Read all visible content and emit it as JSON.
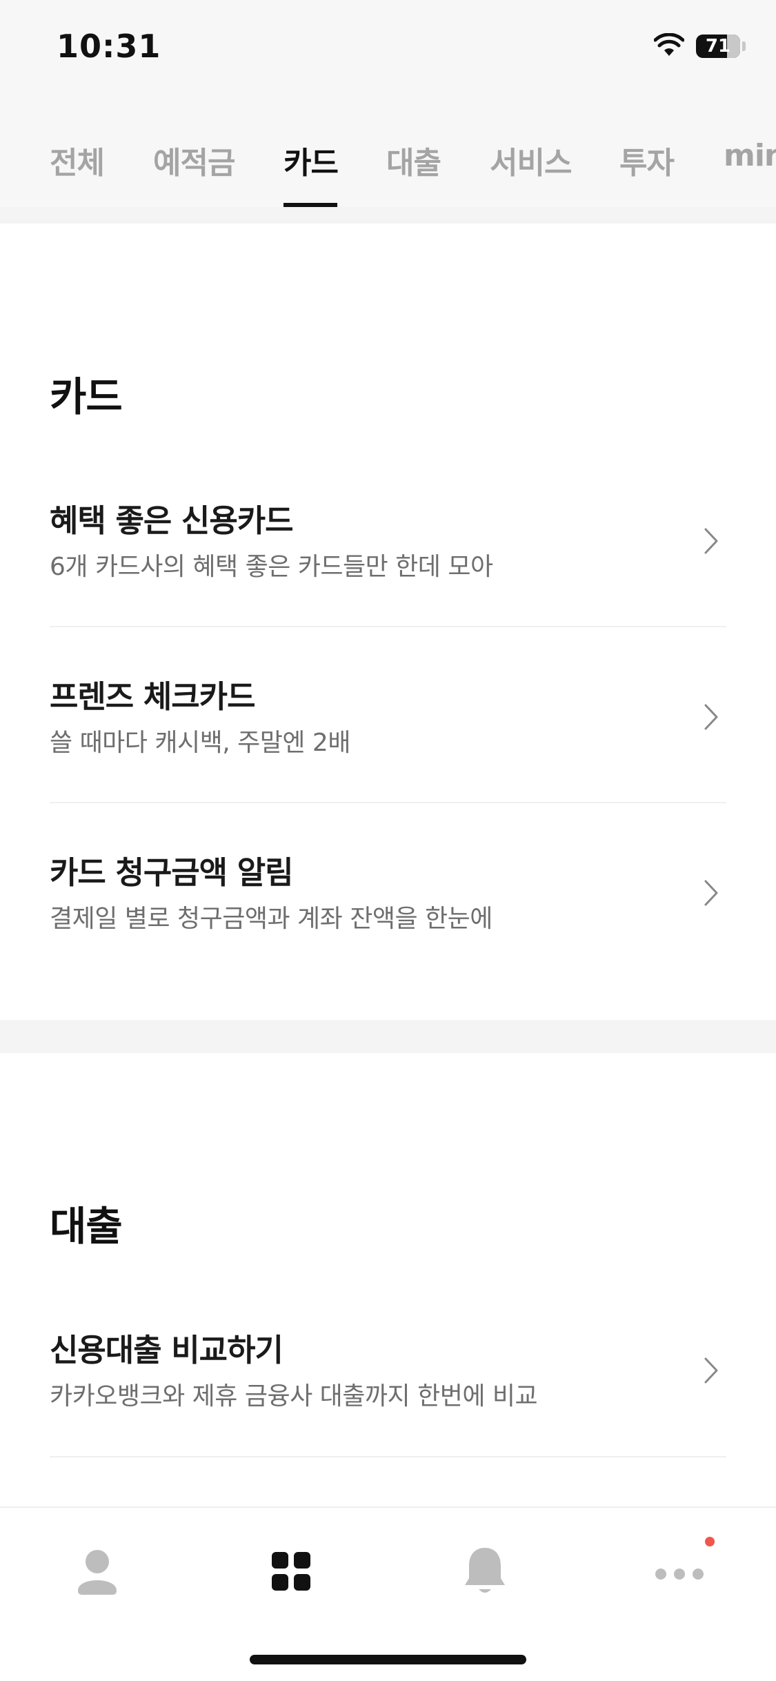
{
  "status_bar": {
    "time": "10:31",
    "battery_level": "71",
    "battery_fraction": 0.71
  },
  "tabs": [
    {
      "label": "전체",
      "active": false
    },
    {
      "label": "예적금",
      "active": false
    },
    {
      "label": "카드",
      "active": true
    },
    {
      "label": "대출",
      "active": false
    },
    {
      "label": "서비스",
      "active": false
    },
    {
      "label": "투자",
      "active": false
    },
    {
      "label": "mini",
      "active": false
    }
  ],
  "sections": [
    {
      "title": "카드",
      "items": [
        {
          "title": "혜택 좋은 신용카드",
          "description": "6개 카드사의 혜택 좋은 카드들만 한데 모아"
        },
        {
          "title": "프렌즈 체크카드",
          "description": "쓸 때마다 캐시백, 주말엔 2배"
        },
        {
          "title": "카드 청구금액 알림",
          "description": "결제일 별로 청구금액과 계좌 잔액을 한눈에"
        }
      ]
    },
    {
      "title": "대출",
      "items": [
        {
          "title": "신용대출 비교하기",
          "description": "카카오뱅크와 제휴 금융사 대출까지 한번에 비교"
        }
      ]
    }
  ],
  "bottom_nav": [
    {
      "icon": "person-icon",
      "active": false
    },
    {
      "icon": "grid-icon",
      "active": true
    },
    {
      "icon": "bell-icon",
      "active": false
    },
    {
      "icon": "more-dots-icon",
      "active": false,
      "badge": true
    }
  ],
  "colors": {
    "active_text": "#111111",
    "inactive_tab": "#a4a4a4",
    "description": "#6e6e6e",
    "badge": "#f0564b"
  }
}
